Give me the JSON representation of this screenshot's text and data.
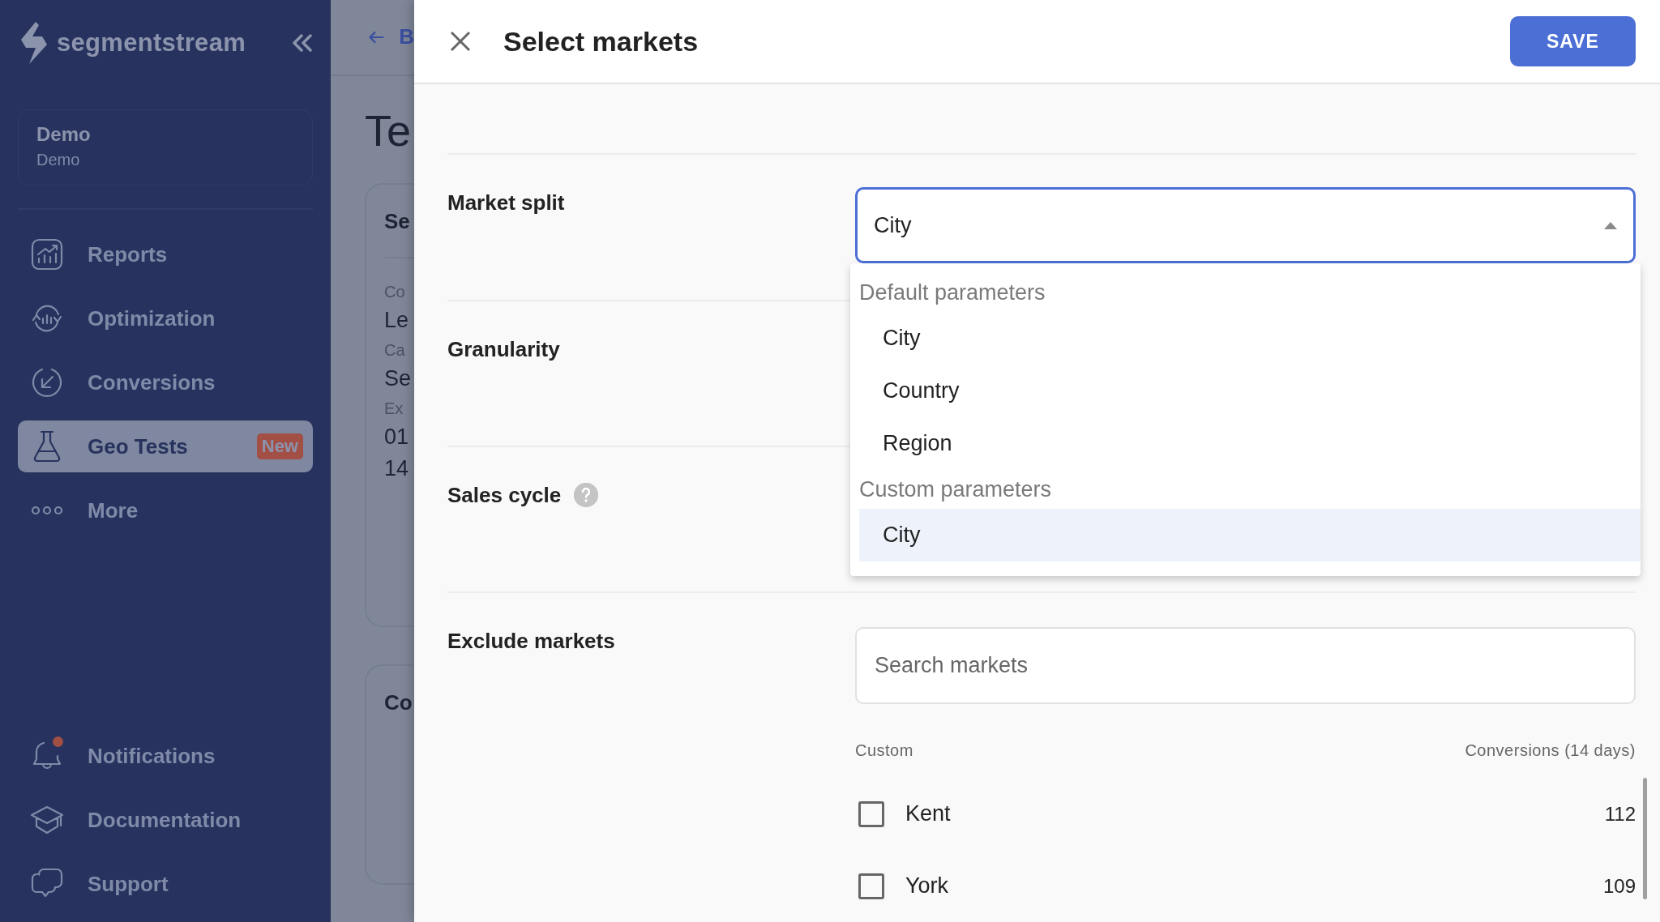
{
  "sidebar": {
    "logo": "segmentstream",
    "workspace": {
      "name": "Demo",
      "subtitle": "Demo"
    },
    "nav": [
      {
        "label": "Reports",
        "selected": false
      },
      {
        "label": "Optimization",
        "selected": false
      },
      {
        "label": "Conversions",
        "selected": false
      },
      {
        "label": "Geo Tests",
        "selected": true,
        "badge": "New"
      },
      {
        "label": "More",
        "selected": false
      }
    ],
    "bottom": [
      {
        "label": "Notifications",
        "unread": true
      },
      {
        "label": "Documentation",
        "unread": false
      },
      {
        "label": "Support",
        "unread": false
      }
    ]
  },
  "background_page": {
    "back_link": "B",
    "title": "Te",
    "card_title": "Se",
    "fields": [
      {
        "label": "Co",
        "value": "Le"
      },
      {
        "label": "Ca",
        "value": "Se"
      },
      {
        "label": "Ex",
        "value": "01"
      }
    ],
    "extra_value": "14",
    "second_card_title": "Co"
  },
  "drawer": {
    "title": "Select markets",
    "save": "SAVE",
    "fields": [
      {
        "label": "Market split",
        "kind": "select",
        "value": "City",
        "expanded": true
      },
      {
        "label": "Granularity",
        "kind": "hidden"
      },
      {
        "label": "Sales cycle",
        "kind": "hidden",
        "help": true
      },
      {
        "label": "Exclude markets",
        "kind": "search",
        "placeholder": "Search markets"
      }
    ],
    "dropdown": {
      "groups": [
        {
          "heading": "Default parameters",
          "options": [
            {
              "label": "City",
              "selected": false
            },
            {
              "label": "Country",
              "selected": false
            },
            {
              "label": "Region",
              "selected": false
            }
          ]
        },
        {
          "heading": "Custom parameters",
          "options": [
            {
              "label": "City",
              "selected": true
            }
          ]
        }
      ]
    },
    "market_list": {
      "columns": [
        "Custom",
        "Conversions (14 days)"
      ],
      "rows": [
        {
          "name": "Kent",
          "checked": false,
          "value": "112"
        },
        {
          "name": "York",
          "checked": false,
          "value": "109"
        }
      ]
    }
  }
}
